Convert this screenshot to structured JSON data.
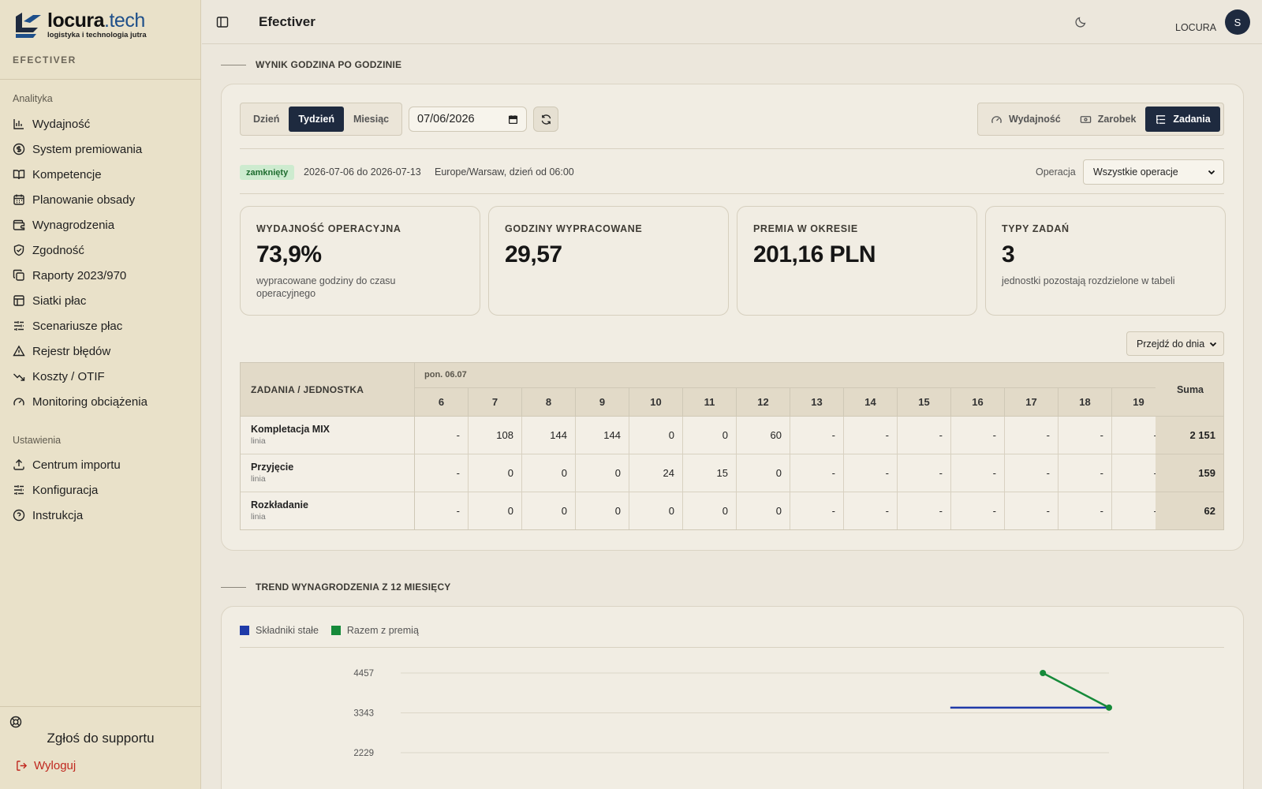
{
  "brand": {
    "name_bold": "locura",
    "name_light": ".tech",
    "tagline": "logistyka i technologia jutra",
    "app_name": "EFECTIVER"
  },
  "sidebar": {
    "group_analytics": "Analityka",
    "analytics_items": [
      {
        "label": "Wydajność",
        "icon": "bar-chart-icon"
      },
      {
        "label": "System premiowania",
        "icon": "dollar-circle-icon"
      },
      {
        "label": "Kompetencje",
        "icon": "book-open-icon"
      },
      {
        "label": "Planowanie obsady",
        "icon": "calendar-icon"
      },
      {
        "label": "Wynagrodzenia",
        "icon": "wallet-icon"
      },
      {
        "label": "Zgodność",
        "icon": "shield-check-icon"
      },
      {
        "label": "Raporty 2023/970",
        "icon": "copy-icon"
      },
      {
        "label": "Siatki płac",
        "icon": "table-icon"
      },
      {
        "label": "Scenariusze płac",
        "icon": "sliders-icon"
      },
      {
        "label": "Rejestr błędów",
        "icon": "warning-triangle-icon"
      },
      {
        "label": "Koszty / OTIF",
        "icon": "trend-down-icon"
      },
      {
        "label": "Monitoring obciążenia",
        "icon": "gauge-icon"
      }
    ],
    "group_settings": "Ustawienia",
    "settings_items": [
      {
        "label": "Centrum importu",
        "icon": "upload-icon"
      },
      {
        "label": "Konfiguracja",
        "icon": "sliders-icon"
      },
      {
        "label": "Instrukcja",
        "icon": "help-circle-icon"
      }
    ],
    "support_label": "Zgłoś do supportu",
    "logout_label": "Wyloguj"
  },
  "header": {
    "title": "Efectiver",
    "user": "LOCURA",
    "avatar_initial": "S"
  },
  "section_hourly": {
    "heading": "WYNIK GODZINA PO GODZINIE",
    "period_tabs": [
      "Dzień",
      "Tydzień",
      "Miesiąc"
    ],
    "active_period": "Tydzień",
    "date_value": "07/06/2026",
    "mode_tabs": [
      {
        "label": "Wydajność",
        "icon": "gauge-icon"
      },
      {
        "label": "Zarobek",
        "icon": "banknote-icon"
      },
      {
        "label": "Zadania",
        "icon": "list-tree-icon"
      }
    ],
    "active_mode": "Zadania",
    "status_badge": "zamknięty",
    "range": "2026-07-06 do 2026-07-13",
    "timezone_note": "Europe/Warsaw, dzień od 06:00",
    "operation_label": "Operacja",
    "operation_value": "Wszystkie operacje",
    "kpis": [
      {
        "label": "WYDAJNOŚĆ OPERACYJNA",
        "value": "73,9%",
        "desc": "wypracowane godziny do czasu operacyjnego"
      },
      {
        "label": "GODZINY WYPRACOWANE",
        "value": "29,57",
        "desc": ""
      },
      {
        "label": "PREMIA W OKRESIE",
        "value": "201,16 PLN",
        "desc": ""
      },
      {
        "label": "TYPY ZADAŃ",
        "value": "3",
        "desc": "jednostki pozostają rozdzielone w tabeli"
      }
    ],
    "goto_day": "Przejdź do dnia",
    "table": {
      "corner_header": "ZADANIA / JEDNOSTKA",
      "day_header": "pon. 06.07",
      "hours": [
        "6",
        "7",
        "8",
        "9",
        "10",
        "11",
        "12",
        "13",
        "14",
        "15",
        "16",
        "17",
        "18",
        "19"
      ],
      "sum_header": "Suma",
      "rows": [
        {
          "name": "Kompletacja MIX",
          "unit": "linia",
          "cells": [
            "-",
            "108",
            "144",
            "144",
            "0",
            "0",
            "60",
            "-",
            "-",
            "-",
            "-",
            "-",
            "-",
            "-"
          ],
          "sum": "2 151"
        },
        {
          "name": "Przyjęcie",
          "unit": "linia",
          "cells": [
            "-",
            "0",
            "0",
            "0",
            "24",
            "15",
            "0",
            "-",
            "-",
            "-",
            "-",
            "-",
            "-",
            "-"
          ],
          "sum": "159"
        },
        {
          "name": "Rozkładanie",
          "unit": "linia",
          "cells": [
            "-",
            "0",
            "0",
            "0",
            "0",
            "0",
            "0",
            "-",
            "-",
            "-",
            "-",
            "-",
            "-",
            "-"
          ],
          "sum": "62"
        }
      ]
    }
  },
  "section_trend": {
    "heading": "TREND WYNAGRODZENIA Z 12 MIESIĘCY"
  },
  "colors": {
    "accent_dark": "#1e2a3f",
    "series_fixed": "#1f3aa8",
    "series_total": "#168a3a",
    "danger": "#c0281f"
  },
  "chart_data": {
    "type": "line",
    "series": [
      {
        "name": "Składniki stałe",
        "color": "#1f3aa8",
        "points": [
          [
            9.6,
            3490
          ],
          [
            12,
            3490
          ]
        ]
      },
      {
        "name": "Razem z premią",
        "color": "#168a3a",
        "points": [
          [
            11,
            4457
          ],
          [
            12,
            3490
          ]
        ]
      }
    ],
    "x_range": [
      1,
      12
    ],
    "y_ticks": [
      "4457",
      "3343",
      "2229"
    ],
    "y_tick_values": [
      4457,
      3343,
      2229
    ],
    "grid": true,
    "legend": "top-left"
  }
}
